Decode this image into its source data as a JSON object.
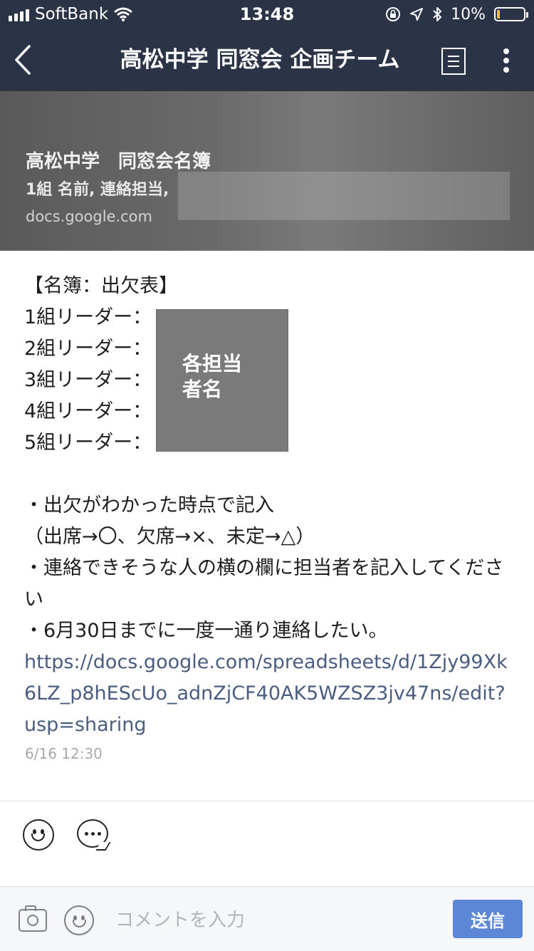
{
  "status_bar": {
    "carrier": "SoftBank",
    "time": "13:48",
    "battery_text": "10%",
    "battery_level": 0.1
  },
  "nav": {
    "title": "高松中学 同窓会 企画チーム"
  },
  "preview": {
    "title": "高松中学　同窓会名簿",
    "description": "1組 名前, 連絡担当,",
    "domain": "docs.google.com"
  },
  "post": {
    "lines": [
      "【名簿：出欠表】",
      "1組リーダー：",
      "2組リーダー：",
      "3組リーダー：",
      "4組リーダー：",
      "5組リーダー："
    ],
    "redaction_label_1": "各担当",
    "redaction_label_2": "者名",
    "notes": [
      "・出欠がわかった時点で記入",
      "（出席→〇、欠席→×、未定→△）",
      "・連絡できそうな人の横の欄に担当者を記入してください",
      "・6月30日までに一度一通り連絡したい。"
    ],
    "link": "https://docs.google.com/spreadsheets/d/1Zjy99Xk6LZ_p8hEScUo_adnZjCF40AK5WZSZ3jv47ns/edit?usp=sharing",
    "timestamp": "6/16 12:30"
  },
  "comment_bar": {
    "placeholder": "コメントを入力",
    "send_label": "送信"
  },
  "colors": {
    "header": "#2b3447",
    "link": "#4a5d80",
    "send_button": "#5b87d6",
    "battery_fill": "#f0c23a"
  },
  "icons": [
    "back-icon",
    "menu-list-icon",
    "more-vertical-icon",
    "smile-icon",
    "comment-bubble-icon",
    "camera-icon",
    "emoji-icon",
    "wifi-icon",
    "signal-icon",
    "location-lock-icon",
    "location-arrow-icon",
    "bluetooth-icon",
    "battery-icon"
  ]
}
